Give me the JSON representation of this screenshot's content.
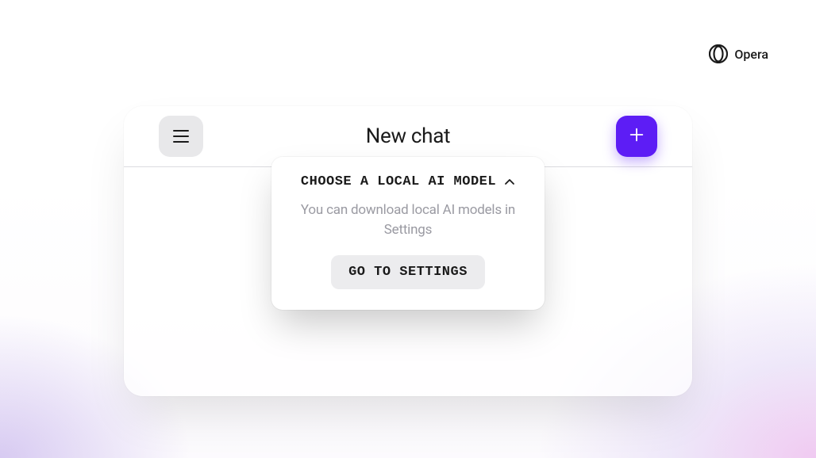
{
  "brand": {
    "name": "Opera"
  },
  "header": {
    "title": "New chat"
  },
  "dropdown": {
    "title": "CHOOSE A LOCAL AI MODEL",
    "description": "You can download local AI models in Settings",
    "button_label": "GO TO SETTINGS"
  }
}
